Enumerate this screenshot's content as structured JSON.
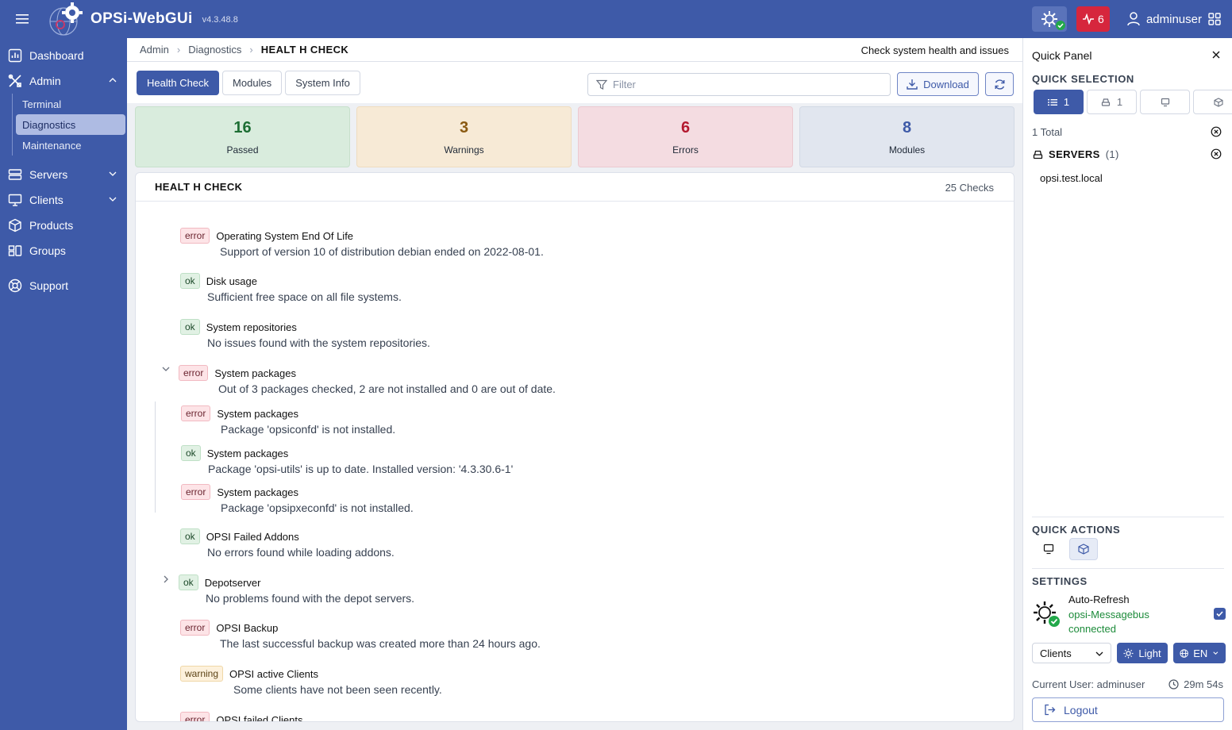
{
  "app": {
    "name": "OPSi-WebGUi",
    "version": "v4.3.48.8"
  },
  "header": {
    "alert_count": "6",
    "username": "adminuser"
  },
  "sidebar": {
    "items": [
      {
        "label": "Dashboard",
        "icon": "chart-icon"
      },
      {
        "label": "Admin",
        "icon": "tools-icon"
      },
      {
        "label": "Servers",
        "icon": "server-icon"
      },
      {
        "label": "Clients",
        "icon": "monitor-icon"
      },
      {
        "label": "Products",
        "icon": "box-icon"
      },
      {
        "label": "Groups",
        "icon": "groups-icon"
      },
      {
        "label": "Support",
        "icon": "lifebuoy-icon"
      }
    ],
    "admin_sub": [
      "Terminal",
      "Diagnostics",
      "Maintenance"
    ]
  },
  "breadcrumb": {
    "items": [
      "Admin",
      "Diagnostics"
    ],
    "current": "HEALT H CHECK",
    "description": "Check system health and issues"
  },
  "tabs": [
    "Health Check",
    "Modules",
    "System Info"
  ],
  "filter": {
    "placeholder": "Filter"
  },
  "toolbar": {
    "download_label": "Download"
  },
  "stats": [
    {
      "value": "16",
      "label": "Passed"
    },
    {
      "value": "3",
      "label": "Warnings"
    },
    {
      "value": "6",
      "label": "Errors"
    },
    {
      "value": "8",
      "label": "Modules"
    }
  ],
  "health_check": {
    "title": "HEALT H CHECK",
    "count": "25 Checks",
    "checks": [
      {
        "status": "error",
        "title": "Operating System End Of Life",
        "message": "Support of version 10 of distribution debian ended on 2022-08-01."
      },
      {
        "status": "ok",
        "title": "Disk usage",
        "message": "Sufficient free space on all file systems."
      },
      {
        "status": "ok",
        "title": "System repositories",
        "message": "No issues found with the system repositories."
      },
      {
        "status": "error",
        "title": "System packages",
        "message": "Out of 3 packages checked, 2 are not installed and 0 are out of date."
      },
      {
        "status": "error",
        "title": "System packages",
        "message": "Package 'opsiconfd' is not installed."
      },
      {
        "status": "ok",
        "title": "System packages",
        "message": "Package 'opsi-utils' is up to date. Installed version: '4.3.30.6-1'"
      },
      {
        "status": "error",
        "title": "System packages",
        "message": "Package 'opsipxeconfd' is not installed."
      },
      {
        "status": "ok",
        "title": "OPSI Failed Addons",
        "message": "No errors found while loading addons."
      },
      {
        "status": "ok",
        "title": "Depotserver",
        "message": "No problems found with the depot servers."
      },
      {
        "status": "error",
        "title": "OPSI Backup",
        "message": "The last successful backup was created more than 24 hours ago."
      },
      {
        "status": "warning",
        "title": "OPSI active Clients",
        "message": "Some clients have not been seen recently."
      },
      {
        "status": "error",
        "title": "OPSI failed Clients",
        "message": ""
      }
    ]
  },
  "quick_panel": {
    "title": "Quick Panel",
    "quick_selection_title": "QUICK SELECTION",
    "selection_counts": [
      "1",
      "1"
    ],
    "total": "1 Total",
    "servers_label": "SERVERS",
    "servers_count": "(1)",
    "servers": [
      "opsi.test.local"
    ],
    "quick_actions_title": "QUICK ACTIONS",
    "settings_title": "SETTINGS",
    "auto_refresh_label": "Auto-Refresh",
    "messagebus_name": "opsi-Messagebus",
    "messagebus_status": "connected",
    "view_select": "Clients",
    "theme_label": "Light",
    "language_label": "EN",
    "current_user": "Current User: adminuser",
    "session_time": "29m 54s",
    "logout_label": "Logout"
  },
  "colors": {
    "primary": "#3e5aa8",
    "error": "#b4192f",
    "ok": "#1d6e34",
    "warning": "#8a5a12"
  }
}
